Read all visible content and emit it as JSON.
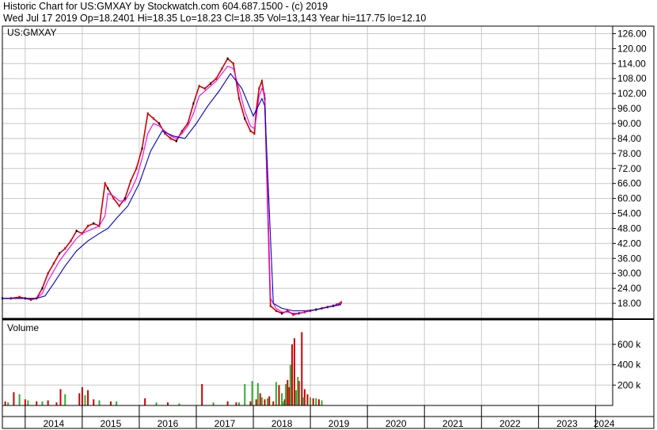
{
  "header": {
    "line1": "Historic Chart for US:GMXAY by Stockwatch.com 604.687.1500 - (c) 2019",
    "line2": "Wed Jul 17 2019   Op=18.2401  Hi=18.35   Lo=18.23   Cl=18.35   Vol=13,143   Year hi=117.75   lo=12.10"
  },
  "chart_data": [
    {
      "type": "line",
      "title": "US:GMXAY",
      "y_ticks": [
        "126.00",
        "120.00",
        "114.00",
        "108.00",
        "102.00",
        "96.00",
        "90.00",
        "84.00",
        "78.00",
        "72.00",
        "66.00",
        "60.00",
        "54.00",
        "48.00",
        "42.00",
        "36.00",
        "30.00",
        "24.00",
        "18.00"
      ],
      "ylim": [
        12,
        129
      ],
      "x_years": [
        "2014",
        "2015",
        "2016",
        "2017",
        "2018",
        "2019",
        "2020",
        "2021",
        "2022",
        "2023",
        "2024"
      ],
      "xlim": [
        2013.6,
        2024.3
      ],
      "grid": true,
      "series": [
        {
          "color": "#cc0000",
          "x": [
            2013.6,
            2013.75,
            2013.9,
            2014.0,
            2014.1,
            2014.2,
            2014.3,
            2014.4,
            2014.5,
            2014.6,
            2014.7,
            2014.8,
            2014.9,
            2015.0,
            2015.1,
            2015.2,
            2015.3,
            2015.4,
            2015.45,
            2015.55,
            2015.65,
            2015.75,
            2015.85,
            2015.95,
            2016.05,
            2016.15,
            2016.25,
            2016.35,
            2016.45,
            2016.55,
            2016.65,
            2016.75,
            2016.85,
            2016.95,
            2017.05,
            2017.15,
            2017.25,
            2017.35,
            2017.45,
            2017.55,
            2017.65,
            2017.75,
            2017.85,
            2017.95,
            2018.02,
            2018.05,
            2018.1,
            2018.15,
            2018.2,
            2018.3,
            2018.4,
            2018.5,
            2018.6,
            2018.7,
            2018.8,
            2018.9,
            2019.0,
            2019.1,
            2019.2,
            2019.3,
            2019.4,
            2019.46,
            2019.54
          ],
          "y": [
            20,
            20,
            20.5,
            20,
            19.5,
            20,
            24,
            30,
            34,
            38,
            40,
            43,
            47,
            46,
            49,
            50,
            49,
            66,
            64,
            60,
            57,
            60,
            67,
            72,
            80,
            94,
            92,
            90,
            86,
            84,
            83,
            87,
            90,
            98,
            105,
            104,
            106,
            108,
            112,
            116,
            114,
            100,
            92,
            87,
            86,
            95,
            104,
            107,
            100,
            17,
            15,
            14,
            15,
            13.5,
            14,
            14.5,
            15,
            15.5,
            16,
            16.5,
            17,
            17.5,
            18.35
          ]
        },
        {
          "color": "#ee00ee",
          "x": [
            2013.6,
            2013.75,
            2013.9,
            2014.0,
            2014.1,
            2014.2,
            2014.3,
            2014.4,
            2014.5,
            2014.6,
            2014.7,
            2014.8,
            2014.9,
            2015.0,
            2015.1,
            2015.2,
            2015.3,
            2015.4,
            2015.45,
            2015.55,
            2015.65,
            2015.75,
            2015.85,
            2015.95,
            2016.05,
            2016.15,
            2016.25,
            2016.35,
            2016.45,
            2016.55,
            2016.65,
            2016.75,
            2016.85,
            2016.95,
            2017.05,
            2017.15,
            2017.25,
            2017.35,
            2017.45,
            2017.55,
            2017.65,
            2017.75,
            2017.85,
            2017.95,
            2018.02,
            2018.05,
            2018.1,
            2018.15,
            2018.2,
            2018.3,
            2018.4,
            2018.5,
            2018.6,
            2018.7,
            2018.8,
            2018.9,
            2019.0,
            2019.1,
            2019.2,
            2019.3,
            2019.4,
            2019.46,
            2019.54
          ],
          "y": [
            20,
            20,
            20,
            20,
            20,
            20,
            22,
            27,
            31,
            35,
            38,
            41,
            44,
            46,
            47,
            48,
            49,
            53,
            62,
            61,
            59,
            59,
            63,
            68,
            76,
            86,
            90,
            89,
            87,
            85,
            84,
            86,
            89,
            94,
            101,
            103,
            105,
            107,
            110,
            113,
            112,
            104,
            95,
            89,
            88,
            92,
            101,
            104,
            102,
            20,
            16,
            14.5,
            14.5,
            14,
            14,
            14.5,
            15,
            15.5,
            16,
            16.5,
            17,
            17.3,
            17.8
          ]
        },
        {
          "color": "#0000cc",
          "x": [
            2013.6,
            2013.8,
            2014.0,
            2014.2,
            2014.35,
            2014.5,
            2014.7,
            2014.9,
            2015.1,
            2015.3,
            2015.45,
            2015.6,
            2015.8,
            2016.0,
            2016.2,
            2016.4,
            2016.6,
            2016.8,
            2017.0,
            2017.2,
            2017.4,
            2017.6,
            2017.8,
            2018.0,
            2018.15,
            2018.2,
            2018.35,
            2018.5,
            2018.7,
            2018.9,
            2019.1,
            2019.3,
            2019.54
          ],
          "y": [
            20,
            20,
            20,
            20,
            21,
            26,
            33,
            39,
            43,
            46,
            48,
            52,
            57,
            66,
            79,
            87,
            85,
            84,
            90,
            97,
            103,
            110,
            104,
            93,
            100,
            97,
            18,
            16,
            15,
            15,
            15.5,
            16.5,
            17.5
          ]
        }
      ]
    },
    {
      "type": "bar",
      "title": "Volume",
      "y_ticks": [
        "600 k",
        "400 k",
        "200 k"
      ],
      "ylim": [
        0,
        840000
      ],
      "x_years": [
        "2014",
        "2015",
        "2016",
        "2017",
        "2018",
        "2019",
        "2020",
        "2021",
        "2022",
        "2023",
        "2024"
      ],
      "xlim": [
        2013.6,
        2024.3
      ],
      "grid": true,
      "series": [
        {
          "color": "#cc0000",
          "x": [
            2013.65,
            2013.8,
            2014.0,
            2014.2,
            2014.4,
            2014.55,
            2014.62,
            2014.95,
            2015.0,
            2015.1,
            2015.2,
            2015.5,
            2016.1,
            2016.5,
            2017.1,
            2017.55,
            2017.7,
            2017.95,
            2018.05,
            2018.12,
            2018.2,
            2018.28,
            2018.35,
            2018.45,
            2018.55,
            2018.6,
            2018.63,
            2018.68,
            2018.72,
            2018.8,
            2018.85,
            2018.9,
            2018.95,
            2019.05,
            2019.15
          ],
          "values": [
            40000,
            130000,
            60000,
            40000,
            50000,
            30000,
            160000,
            120000,
            180000,
            150000,
            60000,
            40000,
            70000,
            30000,
            210000,
            40000,
            30000,
            40000,
            60000,
            120000,
            60000,
            90000,
            40000,
            200000,
            60000,
            250000,
            180000,
            600000,
            660000,
            240000,
            720000,
            160000,
            110000,
            70000,
            60000
          ]
        },
        {
          "color": "#33aa33",
          "x": [
            2013.7,
            2013.9,
            2014.05,
            2014.3,
            2014.7,
            2015.05,
            2015.3,
            2015.6,
            2016.3,
            2016.7,
            2017.3,
            2017.75,
            2017.85,
            2017.98,
            2018.08,
            2018.15,
            2018.25,
            2018.4,
            2018.5,
            2018.53,
            2018.57,
            2018.65,
            2018.75,
            2018.78,
            2018.88,
            2019.0,
            2019.1,
            2019.2
          ],
          "values": [
            30000,
            110000,
            50000,
            40000,
            110000,
            100000,
            50000,
            40000,
            30000,
            20000,
            30000,
            30000,
            210000,
            240000,
            220000,
            80000,
            70000,
            230000,
            120000,
            40000,
            210000,
            400000,
            150000,
            280000,
            80000,
            80000,
            70000,
            50000
          ]
        }
      ]
    }
  ]
}
